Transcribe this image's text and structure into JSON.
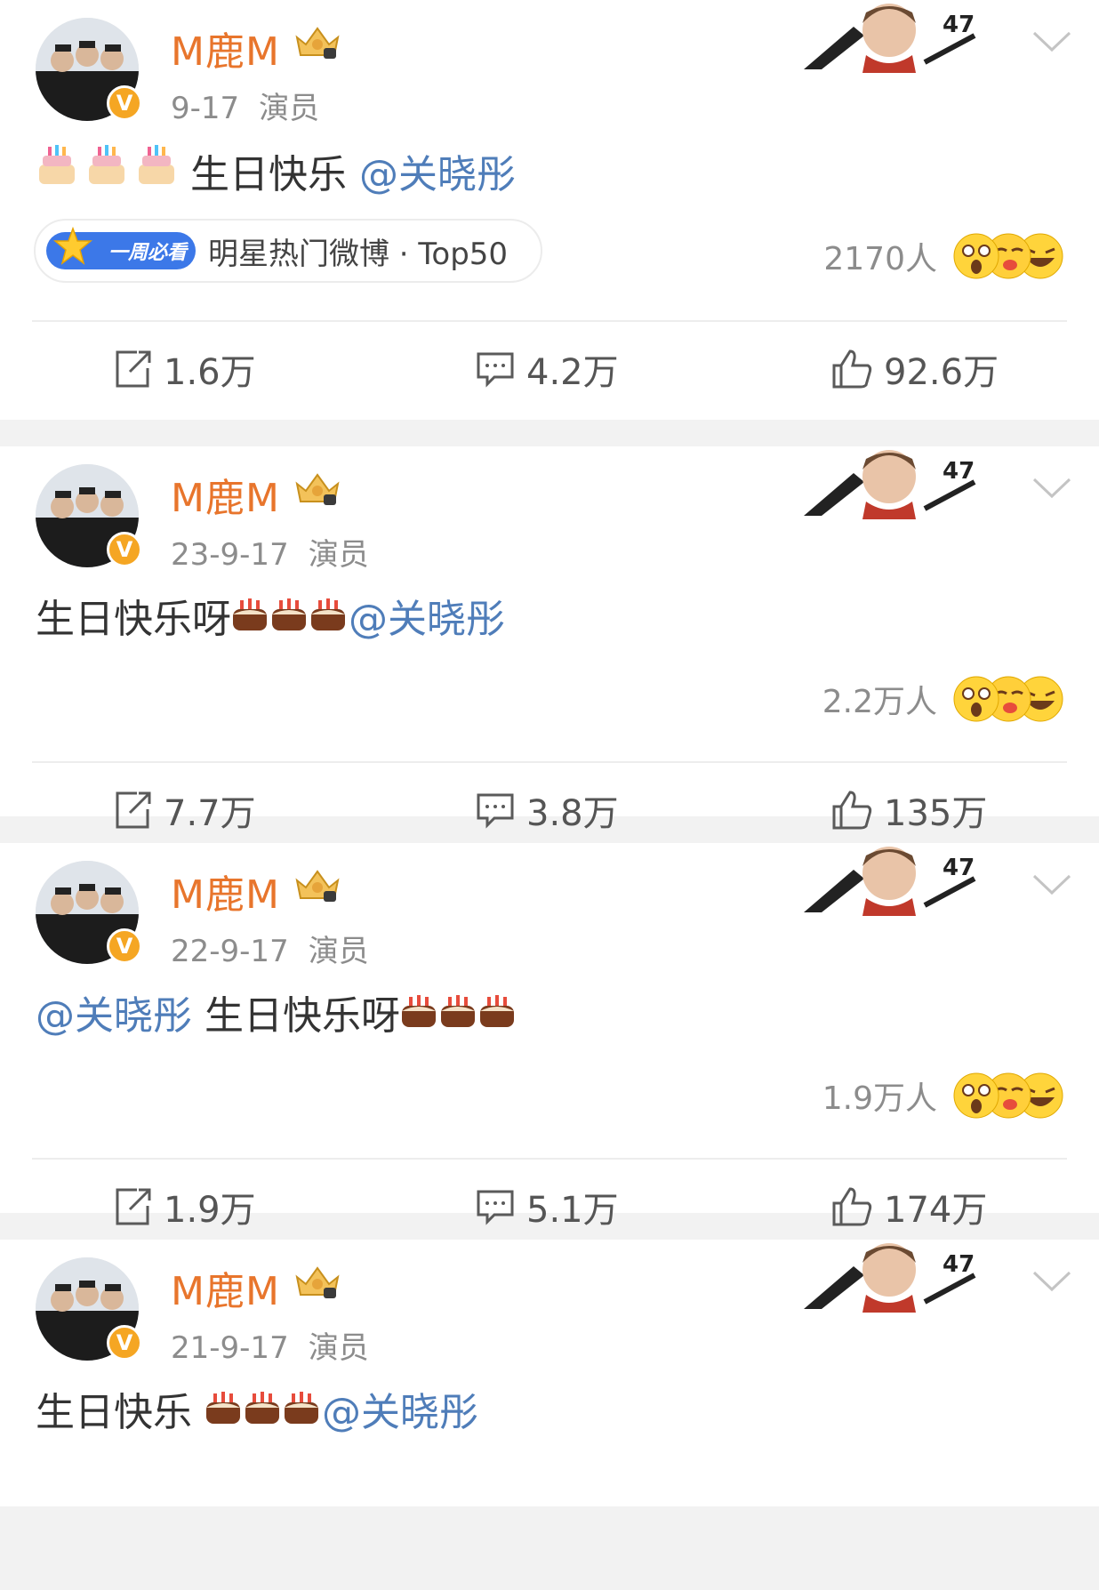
{
  "posts": [
    {
      "username": "M鹿M",
      "date": "9-17",
      "source": "演员",
      "text_before": "",
      "cakes_position": "start",
      "text_after": " 生日快乐 ",
      "mention": "@关晓彤",
      "hot_badge": "一周必看",
      "hot_label": "明星热门微博 · Top50",
      "reaction_count": "2170人",
      "repost": "1.6万",
      "comment": "4.2万",
      "like": "92.6万"
    },
    {
      "username": "M鹿M",
      "date": "23-9-17",
      "source": "演员",
      "text_before": "生日快乐呀",
      "cakes_position": "middle",
      "mention": "@关晓彤",
      "reaction_count": "2.2万人",
      "repost": "7.7万",
      "comment": "3.8万",
      "like": "135万"
    },
    {
      "username": "M鹿M",
      "date": "22-9-17",
      "source": "演员",
      "mention": "@关晓彤",
      "text_after": " 生日快乐呀",
      "cakes_position": "end",
      "reaction_count": "1.9万人",
      "repost": "1.9万",
      "comment": "5.1万",
      "like": "174万"
    },
    {
      "username": "M鹿M",
      "date": "21-9-17",
      "source": "演员",
      "text_before": "生日快乐 ",
      "cakes_position": "middle",
      "mention": "@关晓彤"
    }
  ],
  "colors": {
    "username": "#e8752c",
    "mention": "#4f7db9",
    "meta": "#8c8c8c",
    "vip_badge": "#f5a623"
  },
  "icons": {
    "avatar_badge": "v-verified-icon",
    "member": "crown-icon",
    "menu": "chevron-down-icon",
    "repost": "repost-icon",
    "comment": "comment-icon",
    "like": "thumbs-up-icon"
  }
}
